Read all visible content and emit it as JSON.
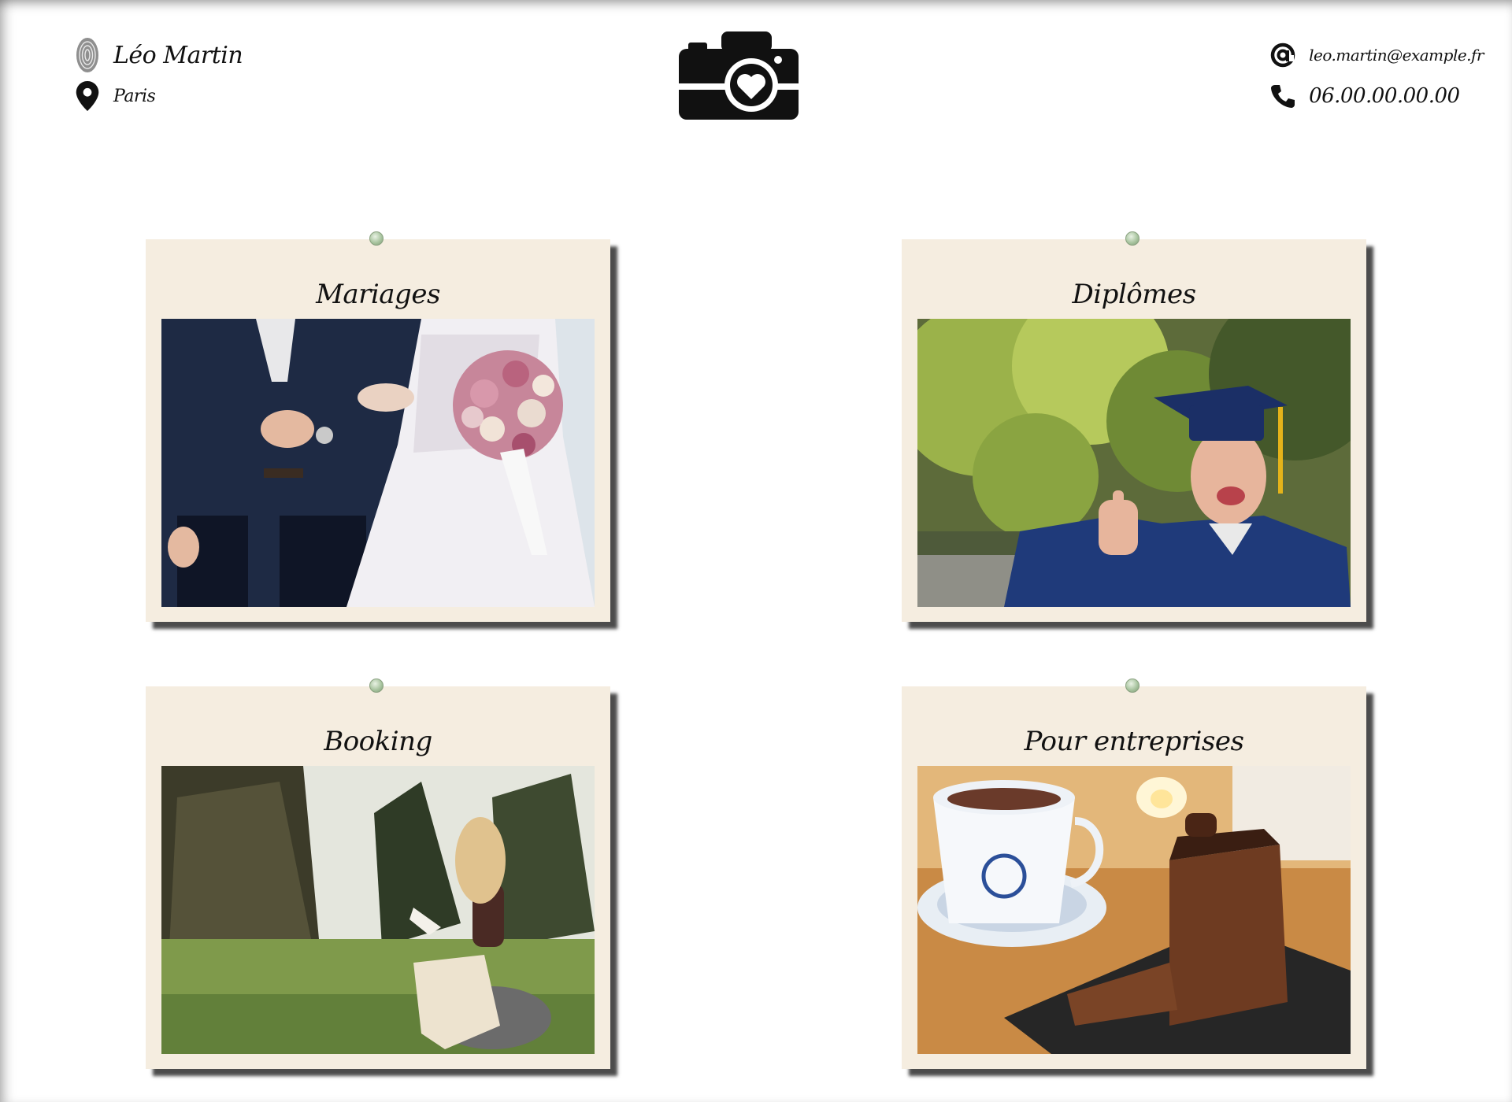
{
  "header": {
    "name": "Léo Martin",
    "city": "Paris",
    "email": "leo.martin@example.fr",
    "phone": "06.00.00.00.00"
  },
  "icons": {
    "fingerprint": "fingerprint-icon",
    "location": "location-pin-icon",
    "email": "at-sign-icon",
    "phone": "phone-icon",
    "logo": "camera-heart-logo"
  },
  "cards": [
    {
      "title": "Mariages",
      "image": "wedding-couple-photo"
    },
    {
      "title": "Diplômes",
      "image": "graduate-photo"
    },
    {
      "title": "Booking",
      "image": "woman-reading-photo"
    },
    {
      "title": "Pour entreprises",
      "image": "coffee-cake-photo"
    }
  ],
  "colors": {
    "card_bg": "#f5ede0",
    "pin": "#a9c5a0",
    "text": "#111111"
  }
}
